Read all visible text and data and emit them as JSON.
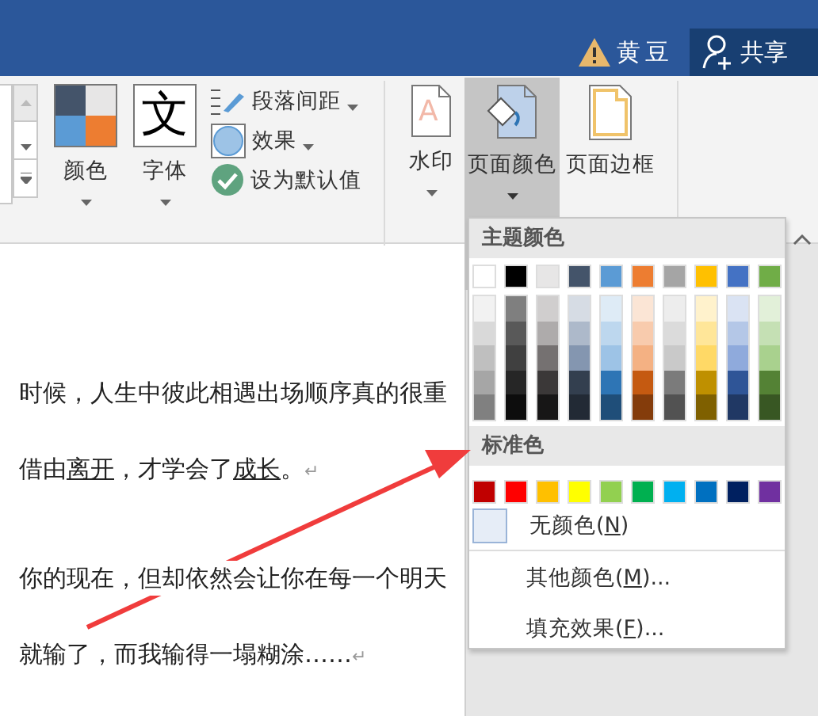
{
  "account": {
    "warning": true,
    "user_name": "黄豆"
  },
  "share_button": {
    "label": "共享"
  },
  "design_buttons": [
    {
      "kind": "theme-colors",
      "label": "颜色",
      "dropdown": true,
      "selected": false
    },
    {
      "kind": "fonts",
      "label": "字体",
      "icon_text": "文",
      "dropdown": true,
      "selected": false
    }
  ],
  "small_buttons": [
    {
      "kind": "spacing",
      "label": "段落间距",
      "dropdown": true
    },
    {
      "kind": "effects",
      "label": "效果",
      "dropdown": true
    },
    {
      "kind": "default",
      "label": "设为默认值",
      "dropdown": false
    }
  ],
  "page_background_buttons": [
    {
      "kind": "watermark",
      "label": "水印",
      "icon_text": "A",
      "dropdown": true,
      "selected": false
    },
    {
      "kind": "page-color",
      "label": "页面颜色",
      "dropdown": true,
      "selected": true
    },
    {
      "kind": "page-border",
      "label": "页面边框",
      "dropdown": false,
      "selected": false
    }
  ],
  "document": {
    "paragraphs": [
      {
        "lines": [
          {
            "parts": [
              {
                "text": "时候，人生中彼此相遇出场顺序真的很重",
                "underlined": false
              }
            ]
          },
          {
            "parts": [
              {
                "text": "借由",
                "underlined": false
              },
              {
                "text": "离开",
                "underlined": true
              },
              {
                "text": "，才学会了",
                "underlined": false
              },
              {
                "text": "成长",
                "underlined": true
              },
              {
                "text": "。",
                "underlined": false
              }
            ],
            "end_mark": "↵"
          }
        ]
      },
      {
        "lines": [
          {
            "parts": [
              {
                "text": "你的现在，但却依然会让你在每一个明天",
                "underlined": false
              }
            ]
          },
          {
            "parts": [
              {
                "text": "就输了，而我输得一塌糊涂……",
                "underlined": false
              }
            ],
            "end_mark": "↵"
          }
        ]
      }
    ]
  },
  "color_menu": {
    "theme_header": "主题颜色",
    "theme_colors": [
      {
        "color": "#ffffff",
        "shades": [
          {
            "color": "#f2f2f2"
          },
          {
            "color": "#d9d9d9"
          },
          {
            "color": "#bfbfbf"
          },
          {
            "color": "#a6a6a6"
          },
          {
            "color": "#808080"
          }
        ]
      },
      {
        "color": "#000000",
        "shades": [
          {
            "color": "#7f7f7f"
          },
          {
            "color": "#595959"
          },
          {
            "color": "#404040"
          },
          {
            "color": "#262626"
          },
          {
            "color": "#0d0d0d"
          }
        ]
      },
      {
        "color": "#e7e6e6",
        "shades": [
          {
            "color": "#d0cece"
          },
          {
            "color": "#aeabab"
          },
          {
            "color": "#757171"
          },
          {
            "color": "#3b3838"
          },
          {
            "color": "#171616"
          }
        ]
      },
      {
        "color": "#44546a",
        "shades": [
          {
            "color": "#d6dce4"
          },
          {
            "color": "#adb9ca"
          },
          {
            "color": "#8496b0"
          },
          {
            "color": "#333f4f"
          },
          {
            "color": "#222a35"
          }
        ]
      },
      {
        "color": "#5b9bd5",
        "shades": [
          {
            "color": "#deebf6"
          },
          {
            "color": "#bdd7ee"
          },
          {
            "color": "#9dc3e6"
          },
          {
            "color": "#2e75b5"
          },
          {
            "color": "#1f4e79"
          }
        ]
      },
      {
        "color": "#ed7d31",
        "shades": [
          {
            "color": "#fbe5d5"
          },
          {
            "color": "#f8cbad"
          },
          {
            "color": "#f4b183"
          },
          {
            "color": "#c55a11"
          },
          {
            "color": "#843c0b"
          }
        ]
      },
      {
        "color": "#a5a5a5",
        "shades": [
          {
            "color": "#ededed"
          },
          {
            "color": "#dbdbdb"
          },
          {
            "color": "#c9c9c9"
          },
          {
            "color": "#7b7b7b"
          },
          {
            "color": "#525252"
          }
        ]
      },
      {
        "color": "#ffc000",
        "shades": [
          {
            "color": "#fff2cc"
          },
          {
            "color": "#ffe699"
          },
          {
            "color": "#ffd966"
          },
          {
            "color": "#bf9000"
          },
          {
            "color": "#7f6000"
          }
        ]
      },
      {
        "color": "#4472c4",
        "shades": [
          {
            "color": "#dae3f3"
          },
          {
            "color": "#b4c7e7"
          },
          {
            "color": "#8faadc"
          },
          {
            "color": "#2f5597"
          },
          {
            "color": "#203864"
          }
        ]
      },
      {
        "color": "#70ad47",
        "shades": [
          {
            "color": "#e2f0d9"
          },
          {
            "color": "#c5e0b4"
          },
          {
            "color": "#a9d18e"
          },
          {
            "color": "#548235"
          },
          {
            "color": "#385723"
          }
        ]
      }
    ],
    "standard_header": "标准色",
    "standard_colors": [
      {
        "color": "#c00000"
      },
      {
        "color": "#ff0000"
      },
      {
        "color": "#ffc000"
      },
      {
        "color": "#ffff00"
      },
      {
        "color": "#92d050"
      },
      {
        "color": "#00b050"
      },
      {
        "color": "#00b0f0"
      },
      {
        "color": "#0070c0"
      },
      {
        "color": "#002060"
      },
      {
        "color": "#7030a0"
      }
    ],
    "no_color": {
      "parts": [
        {
          "text": "无颜色(",
          "underlined": false
        },
        {
          "text": "N",
          "underlined": true
        },
        {
          "text": ")",
          "underlined": false
        }
      ]
    },
    "items": [
      {
        "parts": [
          {
            "text": "其他颜色(",
            "underlined": false
          },
          {
            "text": "M",
            "underlined": true
          },
          {
            "text": ")...",
            "underlined": false
          }
        ]
      },
      {
        "parts": [
          {
            "text": "填充效果(",
            "underlined": false
          },
          {
            "text": "F",
            "underlined": true
          },
          {
            "text": ")...",
            "underlined": false
          }
        ]
      }
    ]
  }
}
